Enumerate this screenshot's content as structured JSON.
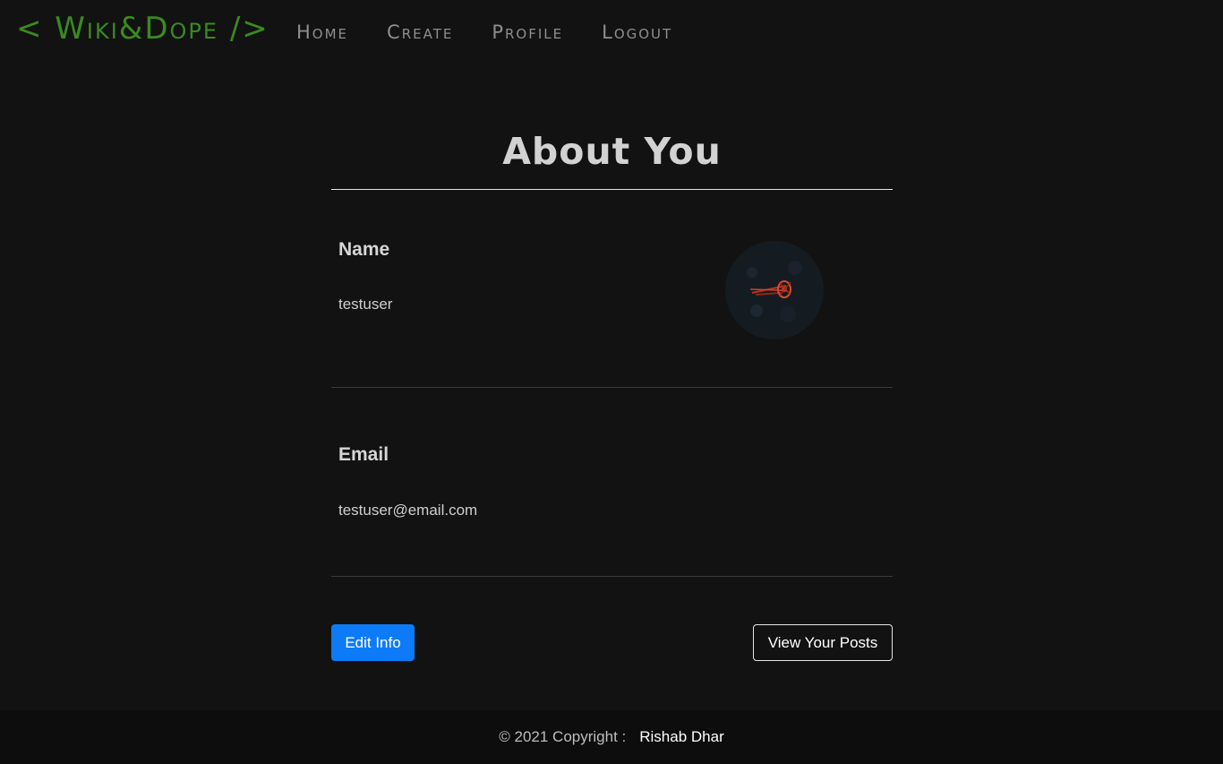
{
  "navbar": {
    "brand": "< Wiki&Dope />",
    "links": [
      {
        "label": "Home"
      },
      {
        "label": "Create"
      },
      {
        "label": "Profile"
      },
      {
        "label": "Logout"
      }
    ]
  },
  "profile": {
    "title": "About You",
    "name_label": "Name",
    "name_value": "testuser",
    "email_label": "Email",
    "email_value": "testuser@email.com",
    "avatar_icon": "profile-avatar-image"
  },
  "actions": {
    "edit_label": "Edit Info",
    "posts_label": "View Your Posts"
  },
  "footer": {
    "copyright": "© 2021 Copyright :",
    "author": "Rishab Dhar"
  },
  "colors": {
    "background": "#121212",
    "brand": "#3a8a1f",
    "primary_button": "#0d7bf7"
  }
}
